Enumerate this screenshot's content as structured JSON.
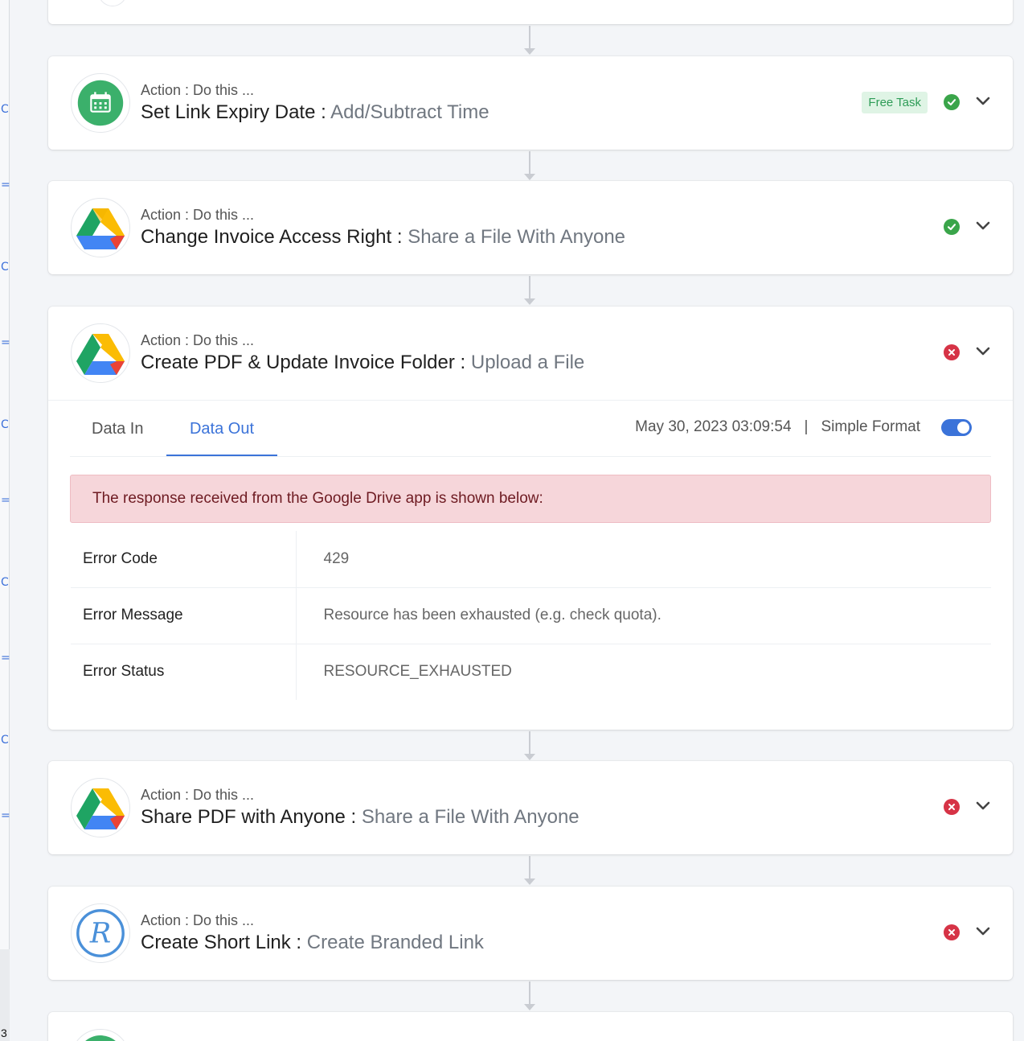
{
  "steps": [
    {
      "subtitle": "Action : Do this ...",
      "name": "Set Link Expiry Date",
      "separator": " : ",
      "action": "Add/Subtract Time",
      "badge": "Free Task",
      "status": "success",
      "app_icon": "calendar-icon"
    },
    {
      "subtitle": "Action : Do this ...",
      "name": "Change Invoice Access Right",
      "separator": " : ",
      "action": "Share a File With Anyone",
      "status": "success",
      "app_icon": "google-drive-icon"
    },
    {
      "subtitle": "Action : Do this ...",
      "name": "Create PDF & Update Invoice Folder",
      "separator": " : ",
      "action": "Upload a File",
      "status": "error",
      "app_icon": "google-drive-icon"
    },
    {
      "subtitle": "Action : Do this ...",
      "name": "Share PDF with Anyone",
      "separator": " : ",
      "action": "Share a File With Anyone",
      "status": "error",
      "app_icon": "google-drive-icon"
    },
    {
      "subtitle": "Action : Do this ...",
      "name": "Create Short Link",
      "separator": " : ",
      "action": "Create Branded Link",
      "status": "error",
      "app_icon": "rebrandly-icon"
    }
  ],
  "detail": {
    "tabs": [
      "Data In",
      "Data Out"
    ],
    "active_tab": "Data Out",
    "timestamp": "May 30, 2023 03:09:54",
    "meta_separator": "|",
    "format_label": "Simple Format",
    "simple_format_on": true,
    "alert": "The response received from the Google Drive app is shown below:",
    "rows": [
      {
        "key": "Error Code",
        "value": "429"
      },
      {
        "key": "Error Message",
        "value": "Resource has been exhausted (e.g. check quota)."
      },
      {
        "key": "Error Status",
        "value": "RESOURCE_EXHAUSTED"
      }
    ]
  },
  "gutter": {
    "page_number": "3"
  },
  "colors": {
    "accent": "#3b73d9",
    "success": "#3aa54a",
    "error": "#d63346",
    "badge_bg": "#dff4e5",
    "badge_text": "#2e9c57",
    "alert_bg": "#f6d6da"
  }
}
